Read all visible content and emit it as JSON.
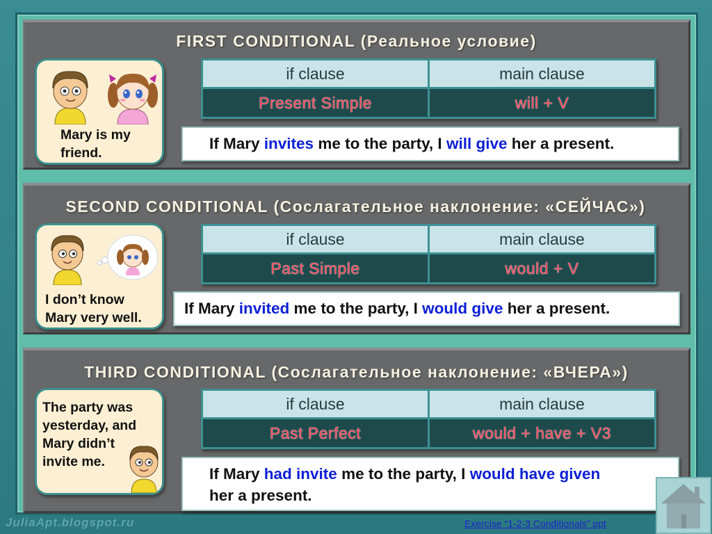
{
  "colors": {
    "frame": "#2f7f86",
    "panel": "#676869",
    "title_text": "#f6f1e1",
    "table_header_bg": "#c9e4e8",
    "table_body_bg": "#1e4a4c",
    "formula_text": "#f0485a",
    "highlight_text": "#0c1fd6",
    "picture_box_bg": "#fcefd3"
  },
  "sections": [
    {
      "title": "FIRST CONDITIONAL (Реальное условие)",
      "caption_lines": [
        "Mary is my",
        "friend."
      ],
      "table": {
        "headers": [
          "if clause",
          "main clause"
        ],
        "formulas": [
          "Present Simple",
          "will + V"
        ]
      },
      "example": {
        "prefix": "If Mary ",
        "if_verb": "invites",
        "middle": " me to the party, I ",
        "main_verb": "will give",
        "suffix": " her a present.",
        "line2": ""
      }
    },
    {
      "title": "SECOND CONDITIONAL (Сослагательное наклонение: «СЕЙЧАС»)",
      "caption_lines": [
        "I don’t know",
        "Mary very well."
      ],
      "table": {
        "headers": [
          "if clause",
          "main clause"
        ],
        "formulas": [
          "Past Simple",
          "would + V"
        ]
      },
      "example": {
        "prefix": "If Mary ",
        "if_verb": "invited",
        "middle": " me to the party, I ",
        "main_verb": "would give",
        "suffix": " her a present.",
        "line2": ""
      }
    },
    {
      "title": "THIRD CONDITIONAL (Сослагательное наклонение: «ВЧЕРА»)",
      "caption_lines": [
        "The party was",
        "yesterday, and",
        "Mary didn’t",
        "invite me."
      ],
      "table": {
        "headers": [
          "if clause",
          "main clause"
        ],
        "formulas": [
          "Past Perfect",
          "would + have + V3"
        ]
      },
      "example": {
        "prefix": "If Mary ",
        "if_verb": "had invite",
        "middle": " me to the party, I ",
        "main_verb": "would have given",
        "suffix": "",
        "line2": "her a present."
      }
    }
  ],
  "footer": {
    "watermark": "JuliaApt.blogspot.ru",
    "exercise_link": "Exercise “1-2-3 Conditionals” ppt",
    "home_icon": "home-icon"
  }
}
